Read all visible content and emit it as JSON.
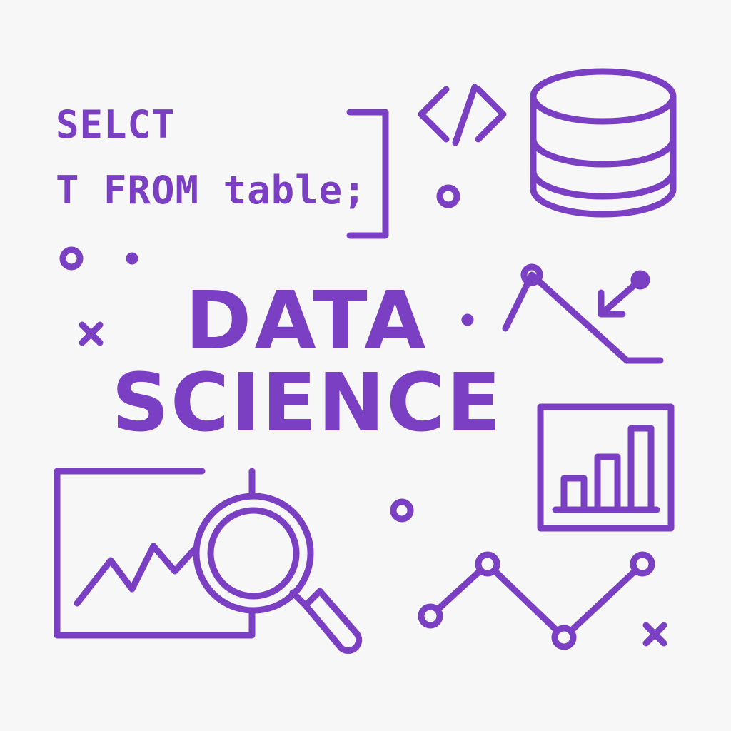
{
  "poster": {
    "code_line_1": "SELCT",
    "code_line_2": "T FROM table;",
    "headline_line_1": "DATA",
    "headline_line_2": "SCIENCE"
  },
  "theme": {
    "accent": "#7b3fc4",
    "background": "#f7f7f7"
  },
  "icons": [
    "code-brackets-icon",
    "database-icon",
    "declining-line-chart-icon",
    "arrow-down-left-icon",
    "bar-chart-frame-icon",
    "magnifying-glass-icon",
    "line-chart-frame-icon",
    "connected-points-line-icon"
  ]
}
